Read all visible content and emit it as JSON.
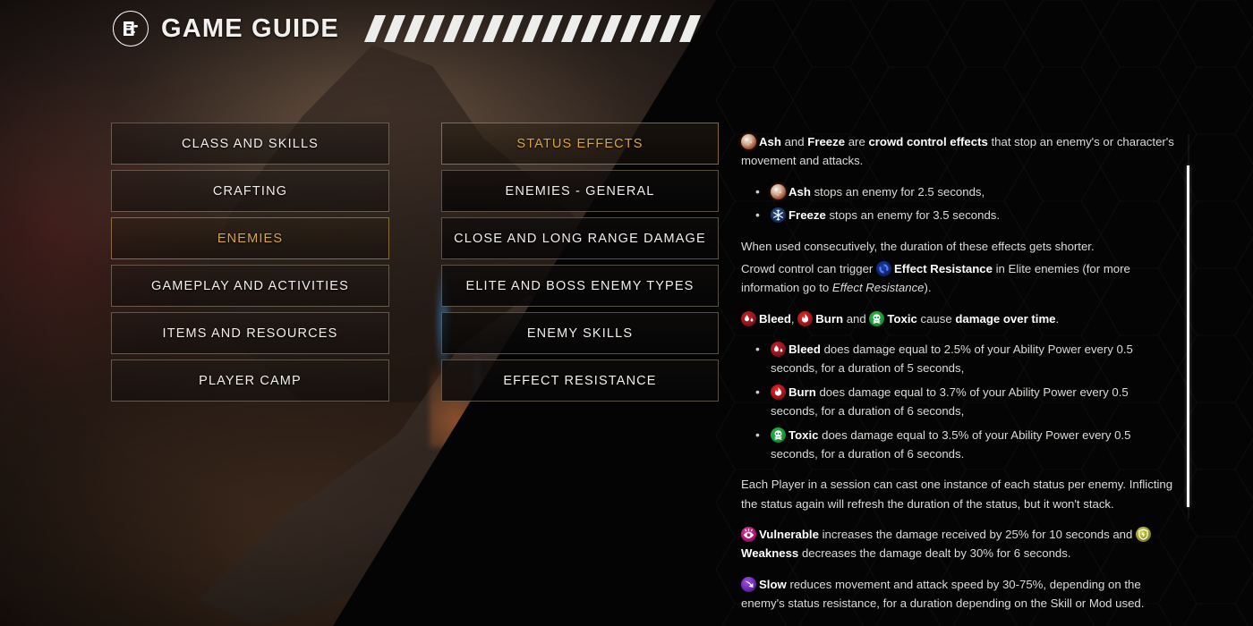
{
  "header": {
    "title": "GAME GUIDE",
    "badge_icon": "guide-book-icon",
    "stripe_count": 17
  },
  "categories": [
    {
      "label": "CLASS AND SKILLS",
      "selected": false
    },
    {
      "label": "CRAFTING",
      "selected": false
    },
    {
      "label": "ENEMIES",
      "selected": true
    },
    {
      "label": "GAMEPLAY AND ACTIVITIES",
      "selected": false
    },
    {
      "label": "ITEMS AND RESOURCES",
      "selected": false
    },
    {
      "label": "PLAYER CAMP",
      "selected": false
    }
  ],
  "subcategories": [
    {
      "label": "STATUS EFFECTS",
      "selected": true
    },
    {
      "label": "ENEMIES - GENERAL",
      "selected": false
    },
    {
      "label": "CLOSE AND LONG RANGE DAMAGE",
      "selected": false
    },
    {
      "label": "ELITE AND BOSS ENEMY TYPES",
      "selected": false
    },
    {
      "label": "ENEMY SKILLS",
      "selected": false
    },
    {
      "label": "EFFECT RESISTANCE",
      "selected": false
    }
  ],
  "content": {
    "p1": {
      "ash": "Ash",
      "and": " and ",
      "freeze": "Freeze",
      "are": " are ",
      "cc": "crowd control effects",
      "rest": " that stop an enemy's or character's movement and attacks."
    },
    "cc_bullets": [
      {
        "name": "Ash",
        "icon": "ash-icon",
        "text": " stops an enemy for 2.5 seconds,"
      },
      {
        "name": "Freeze",
        "icon": "freeze-icon",
        "text": " stops an enemy for 3.5 seconds."
      }
    ],
    "p2_line1": "When used consecutively, the duration of these effects gets shorter.",
    "p2_line2_a": "Crowd control can trigger ",
    "p2_link": "Effect Resistance",
    "p2_line2_b": " in Elite enemies (for more information go to ",
    "p2_italic": "Effect Resistance",
    "p2_line2_c": ").",
    "p3": {
      "bleed": "Bleed",
      "sep1": ", ",
      "burn": "Burn",
      "sep2": " and ",
      "toxic": "Toxic",
      "cause": " cause ",
      "dot": "damage over time",
      "end": "."
    },
    "dot_bullets": [
      {
        "name": "Bleed",
        "icon": "bleed-icon",
        "text": " does damage equal to 2.5% of your Ability Power every 0.5 seconds, for a duration of 5 seconds,"
      },
      {
        "name": "Burn",
        "icon": "burn-icon",
        "text": " does damage equal to 3.7% of your Ability Power every 0.5 seconds, for a duration of 6 seconds,"
      },
      {
        "name": "Toxic",
        "icon": "toxic-icon",
        "text": " does damage equal to 3.5% of your Ability Power every 0.5 seconds, for a duration of 6 seconds."
      }
    ],
    "p4": "Each Player in a session can cast one instance of each status per enemy. Inflicting the status again will refresh the duration of the status, but it won't stack.",
    "p5": {
      "vulnerable": "Vulnerable",
      "mid": " increases the damage received by 25% for 10 seconds and ",
      "weakness": "Weakness",
      "end": " decreases the damage dealt by 30% for 6 seconds."
    },
    "p6": {
      "slow": "Slow",
      "text": " reduces movement and attack speed by 30-75%, depending on the enemy's status resistance, for a duration depending on the Skill or Mod used."
    }
  },
  "scrollbar": {
    "name": "content-scrollbar",
    "thumb_position_percent": 8,
    "thumb_size_percent": 89
  },
  "colors": {
    "accent_gold": "#d9a43f",
    "text_primary": "#f0eeec",
    "text_body": "#dcdad7",
    "panel_bg": "#040404",
    "border": "#c4b4a0"
  }
}
